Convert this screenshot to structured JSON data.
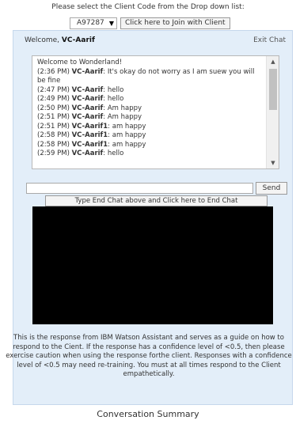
{
  "header": {
    "instruction": "Please select the Client Code from the Drop down list:",
    "client_select_value": "A97287",
    "join_button": "Click here to Join with Client"
  },
  "chat": {
    "welcome_prefix": "Welcome, ",
    "user_name": "VC-Aarif",
    "exit_link": "Exit Chat",
    "greeting": "Welcome to Wonderland!",
    "messages": [
      {
        "time": "(2:36 PM)",
        "sender": "VC-Aarif",
        "text": ": It's okay do not worry as I am suew you will be fine"
      },
      {
        "time": "(2:47 PM)",
        "sender": "VC-Aarif",
        "text": ": hello"
      },
      {
        "time": "(2:49 PM)",
        "sender": "VC-Aarif",
        "text": ": hello"
      },
      {
        "time": "(2:50 PM)",
        "sender": "VC-Aarif",
        "text": ": Am happy"
      },
      {
        "time": "(2:51 PM)",
        "sender": "VC-Aarif",
        "text": ": Am happy"
      },
      {
        "time": "(2:51 PM)",
        "sender": "VC-Aarif1",
        "text": ": am happy"
      },
      {
        "time": "(2:58 PM)",
        "sender": "VC-Aarif1",
        "text": ": am happy"
      },
      {
        "time": "(2:58 PM)",
        "sender": "VC-Aarif1",
        "text": ": am happy"
      },
      {
        "time": "(2:59 PM)",
        "sender": "VC-Aarif",
        "text": ": hello"
      }
    ],
    "input_value": "",
    "send_button": "Send",
    "end_chat_button": "Type End Chat above and Click here to End Chat"
  },
  "note": "This is the response from IBM Watson Assistant and serves as a guide on how to respond to the Cient. If the response has a confidence level of <0.5, then please exercise caution when using the response forthe client. Responses with a confidence level of <0.5 may need re-training. You must at all times respond to the Client empathetically.",
  "footer": {
    "summary_title": "Conversation Summary"
  },
  "icons": {
    "dropdown": "chevron-down-icon",
    "scroll_up": "scroll-up-arrow-icon",
    "scroll_down": "scroll-down-arrow-icon"
  },
  "colors": {
    "panel_background": "#e3eef9",
    "video_background": "#000000"
  }
}
